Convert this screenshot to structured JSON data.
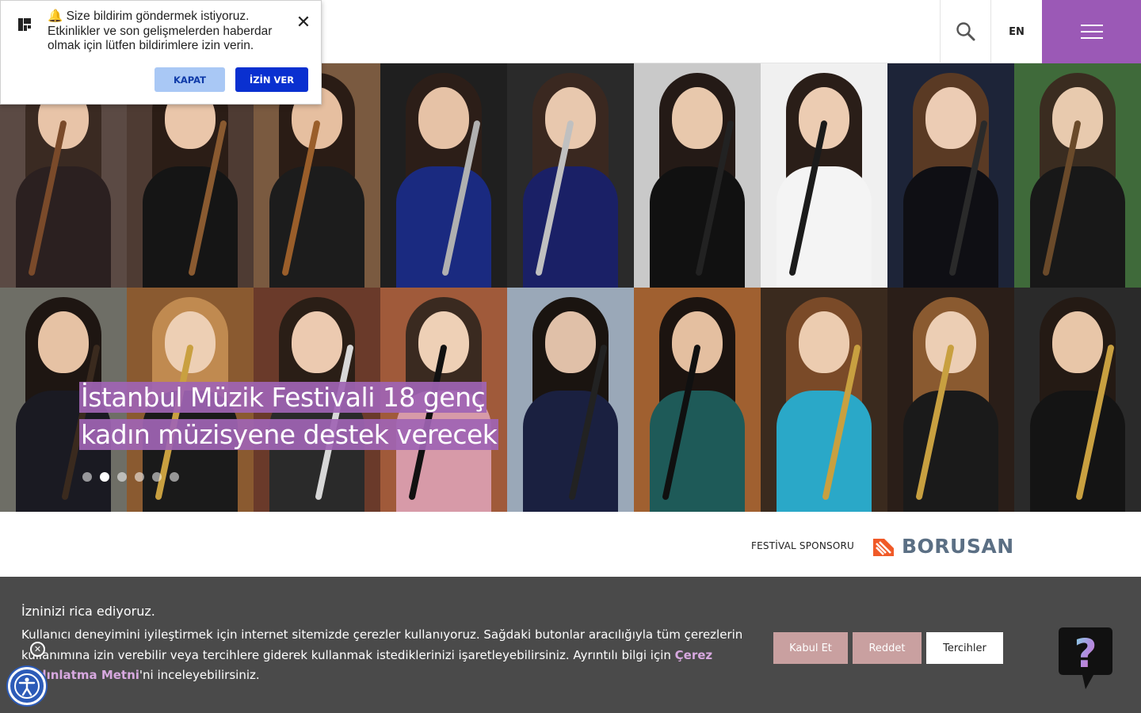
{
  "notification": {
    "message": "🔔 Size bildirim göndermek istiyoruz. Etkinlikler ve son gelişmelerden haberdar olmak için lütfen bildirimlere izin verin.",
    "close_label": "KAPAT",
    "allow_label": "İZİN VER"
  },
  "header": {
    "language": "EN",
    "menu_color": "#9b59b6"
  },
  "hero": {
    "caption": "İstanbul Müzik Festivali 18 genç kadın müzisyene destek verecek",
    "slide_count": 6,
    "active_slide": 2,
    "highlight_color": "#a064b4"
  },
  "sponsor": {
    "label": "FESTİVAL SPONSORU",
    "logo_text": "BORUSAN"
  },
  "cookie": {
    "title": "İzninizi rica ediyoruz.",
    "text_before": "Kullanıcı deneyimini iyileştirmek için internet sitemizde çerezler kullanıyoruz. Sağdaki butonlar aracılığıyla tüm çerezlerin kullanımına izin verebilir veya tercihlere giderek kullanmak istediklerinizi işaretleyebilirsiniz. Ayrıntılı bilgi için ",
    "link_text": "Çerez Aydınlatma Metni",
    "text_after": "'ni inceleyebilirsiniz.",
    "accept_label": "Kabul Et",
    "reject_label": "Reddet",
    "prefs_label": "Tercihler",
    "help_symbol": "?"
  }
}
